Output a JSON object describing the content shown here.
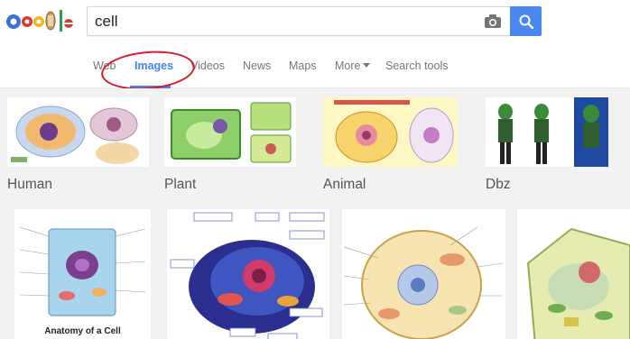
{
  "search": {
    "query": "cell",
    "camera_icon": "camera-icon",
    "search_icon": "search-icon"
  },
  "doodle": {
    "icon": "google-doodle-logo",
    "colors": [
      "#3c6fd6",
      "#d63b2f",
      "#f2b61b",
      "#2e9c4a"
    ]
  },
  "tabs": [
    {
      "label": "Web"
    },
    {
      "label": "Images"
    },
    {
      "label": "Videos"
    },
    {
      "label": "News"
    },
    {
      "label": "Maps"
    },
    {
      "label": "More"
    },
    {
      "label": "Search tools"
    }
  ],
  "active_tab": "Images",
  "related_searches": [
    {
      "label": "Human"
    },
    {
      "label": "Plant"
    },
    {
      "label": "Animal"
    },
    {
      "label": "Dbz"
    }
  ],
  "results": [
    {
      "caption": "Anatomy of a Cell"
    },
    {
      "caption": ""
    },
    {
      "caption": ""
    },
    {
      "caption": ""
    }
  ],
  "colors": {
    "accent": "#4285f4",
    "annotation": "#e0162b",
    "tab_text": "#777777",
    "label_text": "#545454"
  }
}
